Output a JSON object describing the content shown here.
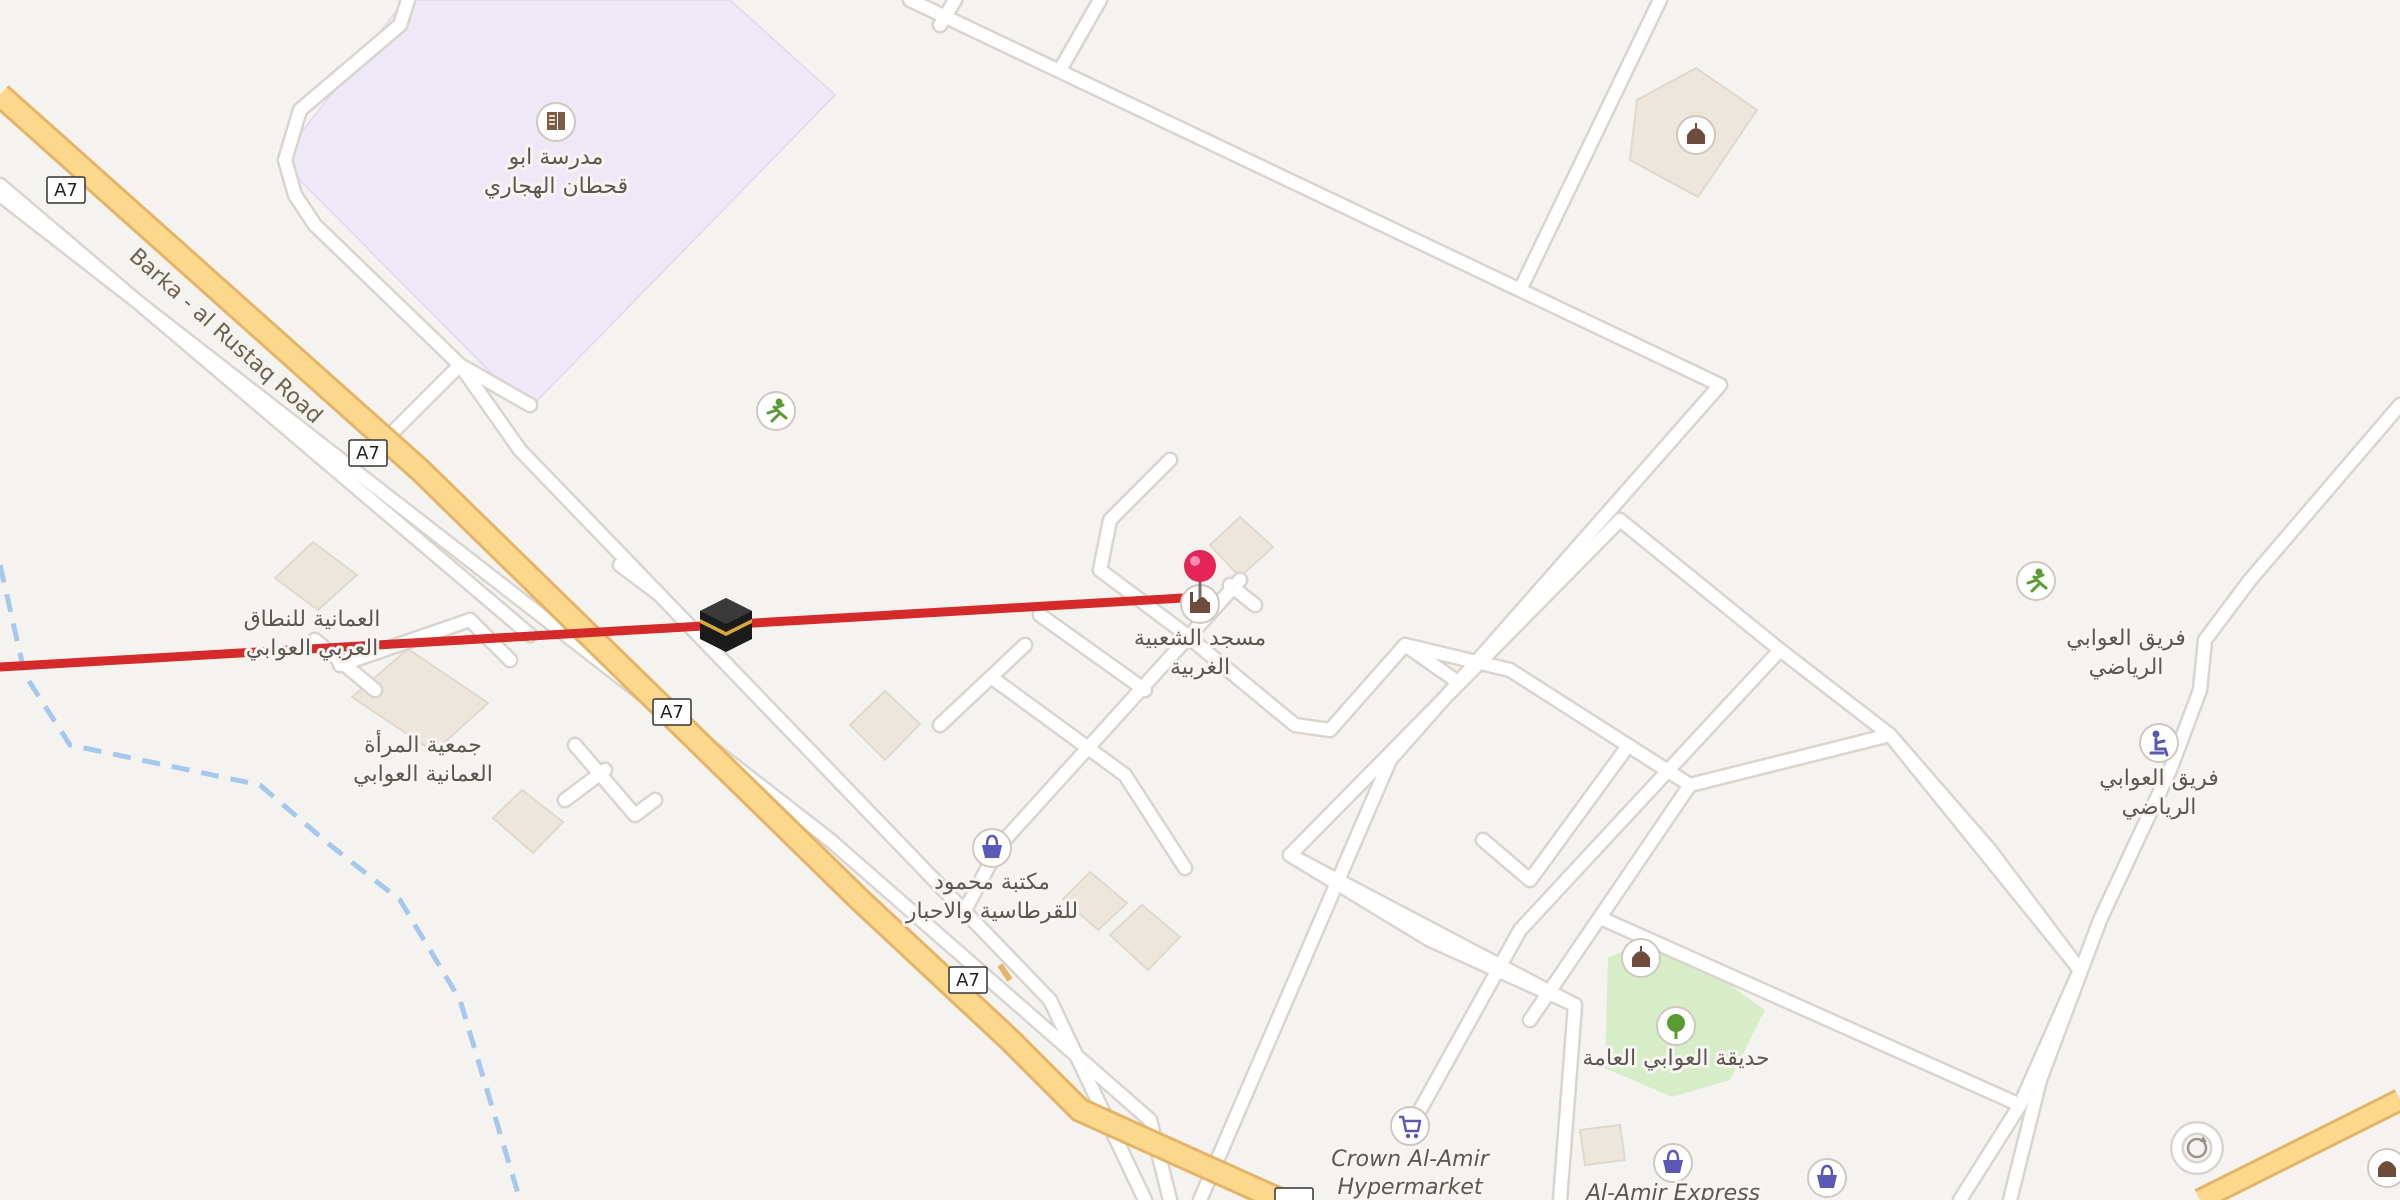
{
  "map": {
    "road_name": "Barka - al Rustaq Road",
    "route_shield": "A7",
    "colors": {
      "background": "#f5f3f0",
      "primary_road_fill": "#fcd88c",
      "primary_road_casing": "#e6b469",
      "minor_road": "#ffffff",
      "minor_road_casing": "#d9d4ce",
      "school_area": "#efe9f7",
      "park_area": "#d7edc8",
      "waterway": "#a6c8ec",
      "route_line": "#d42a2a",
      "pin": "#e5245a",
      "shop_icon": "#5b58b6",
      "leisure_icon": "#5b9b33",
      "religion_icon": "#6e4b3a"
    },
    "labels": {
      "school_l1": "مدرسة ابو",
      "school_l2": "قحطان الهجاري",
      "association_l1": "العمانية للنطاق",
      "association_l2": "العربي العوابي",
      "women_l1": "جمعية المرأة",
      "women_l2": "العمانية العوابي",
      "mosque_l1": "مسجد الشعبية",
      "mosque_l2": "الغربية",
      "library_l1": "مكتبة محمود",
      "library_l2": "للقرطاسية والاحبار",
      "team1_l1": "فريق العوابي",
      "team1_l2": "الرياضي",
      "team2_l1": "فريق العوابي",
      "team2_l2": "الرياضي",
      "park": "حديقة العوابي العامة",
      "crown_l1": "Crown Al-Amir",
      "crown_l2": "Hypermarket",
      "express": "Al-Amir Express"
    },
    "icons": [
      "school-icon",
      "sports-centre-icon",
      "kaaba-icon",
      "mosque-icon",
      "shop-icon",
      "supermarket-icon",
      "park-tree-icon",
      "sports-club-icon",
      "location-pin-icon",
      "roundabout-icon"
    ]
  }
}
